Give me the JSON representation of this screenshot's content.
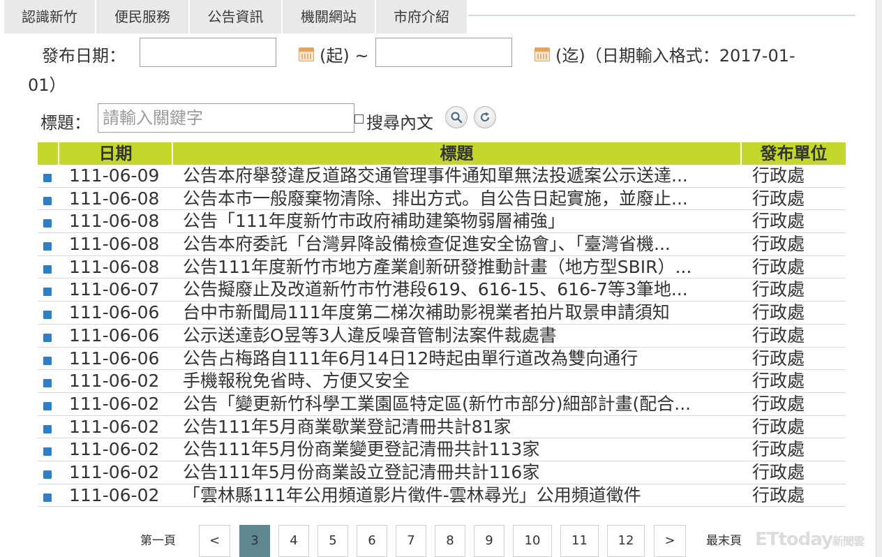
{
  "nav": [
    {
      "label": "認識新竹"
    },
    {
      "label": "便民服務"
    },
    {
      "label": "公告資訊"
    },
    {
      "label": "機關網站"
    },
    {
      "label": "市府介紹"
    }
  ],
  "filter": {
    "date_label": "發布日期：",
    "start_suffix": "(起) ~",
    "end_suffix": "(迄)（日期輸入格式：2017-01-",
    "format_wrap": "01）",
    "title_label": "標題：",
    "keyword_placeholder": "請輸入關鍵字",
    "search_content_label": "搜尋內文"
  },
  "table": {
    "headers": {
      "date": "日期",
      "title": "標題",
      "unit": "發布單位"
    },
    "rows": [
      {
        "date": "111-06-09",
        "title": "公告本府舉發違反道路交通管理事件通知單無法投遞案公示送達...",
        "unit": "行政處"
      },
      {
        "date": "111-06-08",
        "title": "公告本市一般廢棄物清除、排出方式。自公告日起實施，並廢止...",
        "unit": "行政處"
      },
      {
        "date": "111-06-08",
        "title": "公告「111年度新竹市政府補助建築物弱層補強」",
        "unit": "行政處"
      },
      {
        "date": "111-06-08",
        "title": "公告本府委託「台灣昇降設備檢查促進安全協會」、「臺灣省機...",
        "unit": "行政處"
      },
      {
        "date": "111-06-08",
        "title": "公告111年度新竹市地方產業創新研發推動計畫（地方型SBIR）...",
        "unit": "行政處"
      },
      {
        "date": "111-06-07",
        "title": "公告擬廢止及改道新竹市竹港段619、616-15、616-7等3筆地...",
        "unit": "行政處"
      },
      {
        "date": "111-06-06",
        "title": "台中市新聞局111年度第二梯次補助影視業者拍片取景申請須知",
        "unit": "行政處"
      },
      {
        "date": "111-06-06",
        "title": "公示送達彭O昱等3人違反噪音管制法案件裁處書",
        "unit": "行政處"
      },
      {
        "date": "111-06-06",
        "title": "公告占梅路自111年6月14日12時起由單行道改為雙向通行",
        "unit": "行政處"
      },
      {
        "date": "111-06-02",
        "title": "手機報稅免省時、方便又安全",
        "unit": "行政處"
      },
      {
        "date": "111-06-02",
        "title": "公告「變更新竹科學工業園區特定區(新竹市部分)細部計畫(配合...",
        "unit": "行政處"
      },
      {
        "date": "111-06-02",
        "title": "公告111年5月商業歇業登記清冊共計81家",
        "unit": "行政處"
      },
      {
        "date": "111-06-02",
        "title": "公告111年5月份商業變更登記清冊共計113家",
        "unit": "行政處"
      },
      {
        "date": "111-06-02",
        "title": "公告111年5月份商業設立登記清冊共計116家",
        "unit": "行政處"
      },
      {
        "date": "111-06-02",
        "title": "「雲林縣111年公用頻道影片徵件-雲林尋光」公用頻道徵件",
        "unit": "行政處"
      }
    ]
  },
  "pagination": {
    "first": "第一頁",
    "prev": "<",
    "pages": [
      "3",
      "4",
      "5",
      "6",
      "7",
      "8",
      "9",
      "10",
      "11",
      "12"
    ],
    "current": "3",
    "next": ">",
    "last": "最末頁"
  },
  "watermark": {
    "main": "ETtoday",
    "sub": "新聞雲"
  },
  "colors": {
    "header_bg": "#c3d82a",
    "bullet": "#2f7fc6",
    "active_page": "#5f8792"
  }
}
